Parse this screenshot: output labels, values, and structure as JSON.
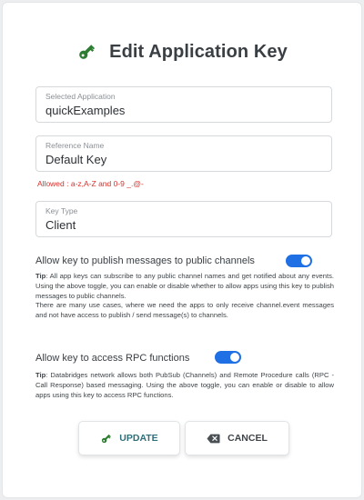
{
  "dialog": {
    "title": "Edit Application Key",
    "title_icon": "key-icon",
    "accent_color": "#2e7d32"
  },
  "fields": {
    "application": {
      "label": "Selected Application",
      "value": "quickExamples"
    },
    "reference_name": {
      "label": "Reference Name",
      "value": "Default Key"
    },
    "reference_hint": "Allowed : a-z,A-Z and 0-9 _.@-",
    "key_type": {
      "label": "Key Type",
      "value": "Client"
    }
  },
  "toggles": {
    "publish": {
      "label": "Allow key to publish messages to public channels",
      "on": true,
      "tip_prefix": "Tip",
      "tip_line1": ": All app keys can subscribe to any public channel names and get notified about any events. Using the above toggle, you can enable or disable whether to allow apps using this key to publish messages to public channels.",
      "tip_line2": "There are many use cases, where we need the apps to only receive channel.event messages and not have access to publish / send message(s) to channels."
    },
    "rpc": {
      "label": "Allow key to access RPC functions",
      "on": true,
      "tip_prefix": "Tip",
      "tip_text": ": Databridges network allows both PubSub (Channels) and Remote Procedure calls (RPC - Call Response) based messaging. Using the above toggle, you can enable or disable to allow apps using this key to access RPC functions."
    }
  },
  "buttons": {
    "update": {
      "label": "UPDATE",
      "icon": "key-icon"
    },
    "cancel": {
      "label": "CANCEL",
      "icon": "backspace-icon"
    }
  },
  "colors": {
    "toggle_on": "#1f6fe5",
    "hint": "#d9302a"
  }
}
